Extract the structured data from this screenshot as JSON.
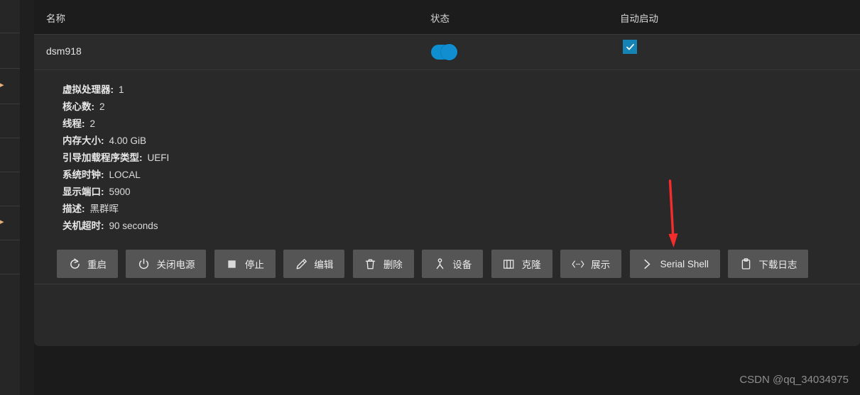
{
  "table": {
    "columns": [
      {
        "key": "name",
        "label": "名称"
      },
      {
        "key": "state",
        "label": "状态"
      },
      {
        "key": "autostart",
        "label": "自动启动"
      }
    ],
    "row": {
      "name": "dsm918",
      "state_on": true,
      "autostart_checked": true
    }
  },
  "details": [
    {
      "label": "虚拟处理器:",
      "value": "1"
    },
    {
      "label": "核心数:",
      "value": "2"
    },
    {
      "label": "线程:",
      "value": "2"
    },
    {
      "label": "内存大小:",
      "value": "4.00 GiB"
    },
    {
      "label": "引导加载程序类型:",
      "value": "UEFI"
    },
    {
      "label": "系统时钟:",
      "value": "LOCAL"
    },
    {
      "label": "显示端口:",
      "value": "5900"
    },
    {
      "label": "描述:",
      "value": "黑群晖"
    },
    {
      "label": "关机超时:",
      "value": "90 seconds"
    }
  ],
  "buttons": [
    {
      "icon": "restart-icon",
      "label": "重启"
    },
    {
      "icon": "power-off-icon",
      "label": "关闭电源"
    },
    {
      "icon": "stop-icon",
      "label": "停止"
    },
    {
      "icon": "pencil-icon",
      "label": "编辑"
    },
    {
      "icon": "trash-icon",
      "label": "删除"
    },
    {
      "icon": "device-icon",
      "label": "设备"
    },
    {
      "icon": "clone-icon",
      "label": "克隆"
    },
    {
      "icon": "code-icon",
      "label": "展示"
    },
    {
      "icon": "chevron-right-icon",
      "label": "Serial Shell"
    },
    {
      "icon": "clipboard-icon",
      "label": "下载日志"
    }
  ],
  "watermark": {
    "text": "CSDN @qq_34034975"
  },
  "colors": {
    "accent_blue": "#108ed0",
    "checkbox_blue": "#1683b5",
    "button_gray": "#555555",
    "panel_bg": "#292929",
    "header_bg": "#1c1c1c",
    "page_bg": "#1b1b1b",
    "annotation_red": "#f42c2c",
    "rail_arrow": "#e8b07a"
  }
}
